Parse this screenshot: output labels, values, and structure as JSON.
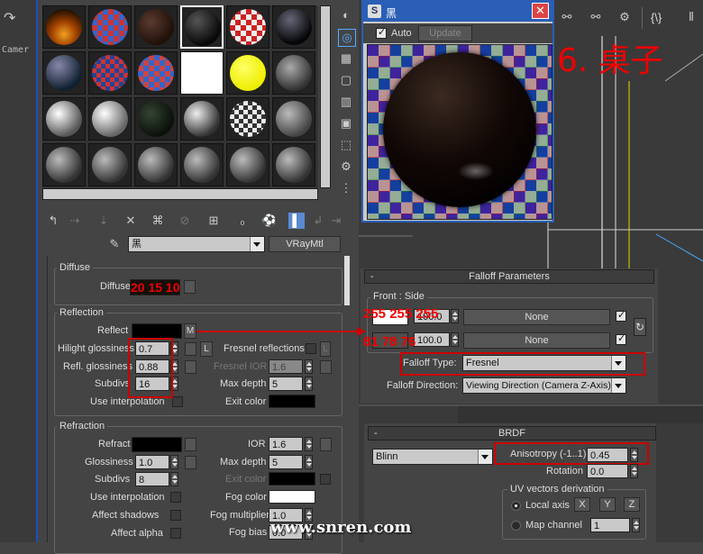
{
  "viewport": {
    "camera_label": "Camer"
  },
  "top_toolbar": {
    "braces": "{\\}"
  },
  "editor": {
    "material_name": "黑",
    "material_type": "VRayMtl",
    "diffuse_title": "Diffuse",
    "diffuse_label": "Diffuse",
    "reflection_title": "Reflection",
    "reflect_label": "Reflect",
    "m_button": "M",
    "hilight_label": "Hilight glossiness",
    "hilight_value": "0.7",
    "l_button": "L",
    "fresnel_label": "Fresnel reflections",
    "refl_gloss_label": "Refl. glossiness",
    "refl_gloss_value": "0.88",
    "fresnel_ior_label": "Fresnel IOR",
    "fresnel_ior_value": "1.6",
    "subdivs_label": "Subdivs",
    "subdivs_value": "16",
    "max_depth_label": "Max depth",
    "max_depth_value": "5",
    "use_interp_label": "Use interpolation",
    "exit_color_label": "Exit color",
    "refraction_title": "Refraction",
    "refract_label": "Refract",
    "ior_label": "IOR",
    "ior_value": "1.6",
    "glossiness_label": "Glossiness",
    "glossiness_value": "1.0",
    "r_max_depth_label": "Max depth",
    "r_max_depth_value": "5",
    "r_subdivs_label": "Subdivs",
    "r_subdivs_value": "8",
    "r_exit_color_label": "Exit color",
    "r_use_interp_label": "Use interpolation",
    "fog_color_label": "Fog color",
    "affect_shadows_label": "Affect shadows",
    "fog_mult_label": "Fog multiplier",
    "fog_mult_value": "1.0",
    "affect_alpha_label": "Affect alpha",
    "fog_bias_label": "Fog bias",
    "fog_bias_value": "0.0"
  },
  "annotations": {
    "diffuse_rgb": "20  15  10",
    "front_rgb": "255 255 255",
    "side_rgb": "81  78  76",
    "chinese_title": "6. 桌子",
    "watermark": "www.snren.com"
  },
  "preview": {
    "title": "黑",
    "auto_label": "Auto",
    "update_label": "Update"
  },
  "falloff": {
    "header": "Falloff Parameters",
    "front_side_label": "Front : Side",
    "front_value": "100.0",
    "side_value": "100.0",
    "none1": "None",
    "none2": "None",
    "type_label": "Falloff Type:",
    "type_value": "Fresnel",
    "direction_label": "Falloff Direction:",
    "direction_value": "Viewing Direction (Camera Z-Axis)"
  },
  "brdf": {
    "header": "BRDF",
    "model": "Blinn",
    "anisotropy_label": "Anisotropy (-1..1)",
    "anisotropy_value": "0.45",
    "rotation_label": "Rotation",
    "rotation_value": "0.0",
    "uv_title": "UV vectors derivation",
    "local_axis_label": "Local axis",
    "x": "X",
    "y": "Y",
    "z": "Z",
    "map_channel_label": "Map channel",
    "map_channel_value": "1"
  },
  "colors": {
    "accent_red": "#cc0000",
    "panel": "#444444",
    "title_blue": "#2a5fb5"
  }
}
